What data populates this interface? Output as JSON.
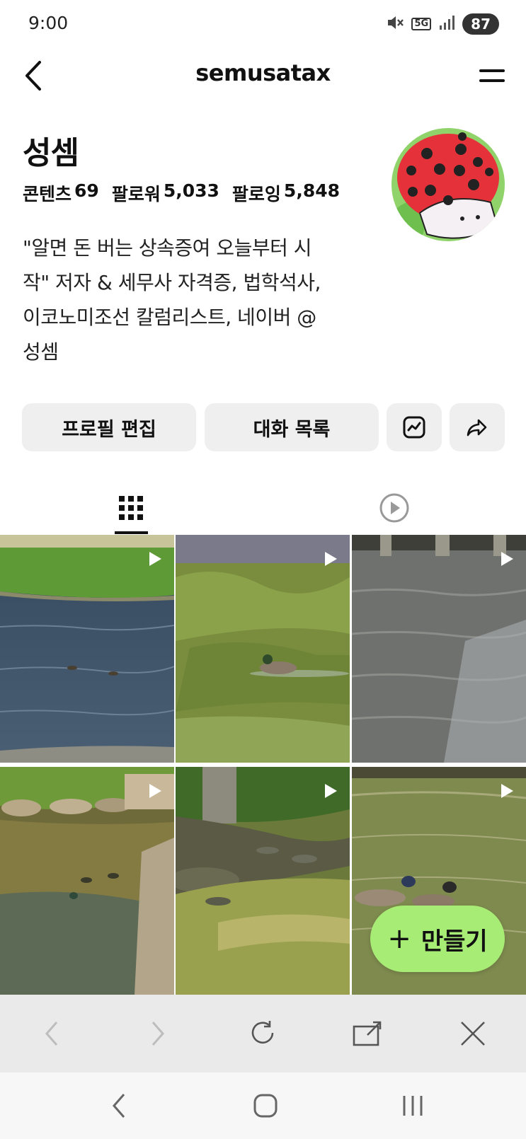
{
  "status_bar": {
    "time": "9:00",
    "network": "5G",
    "battery": "87",
    "icons": [
      "mute-icon",
      "5g-icon",
      "signal-icon",
      "battery-icon"
    ]
  },
  "header": {
    "title": "semusatax",
    "back_icon": "chevron-left-icon",
    "menu_icon": "hamburger-menu-icon"
  },
  "profile": {
    "name": "성셈",
    "stats": [
      {
        "label": "콘텐츠",
        "value": "69"
      },
      {
        "label": "팔로워",
        "value": "5,033"
      },
      {
        "label": "팔로잉",
        "value": "5,848"
      }
    ],
    "bio_lines": [
      "\"알면 돈 버는 상속증여 오늘부터 시",
      "작\" 저자 & 세무사 자격증, 법학석사,",
      "이코노미조선 칼럼리스트, 네이버 @",
      "성셈"
    ],
    "avatar_icon": "ladybug-avatar"
  },
  "actions": {
    "edit_profile": "프로필 편집",
    "conversation_list": "대화 목록",
    "insights_icon": "insights-icon",
    "share_icon": "share-icon"
  },
  "tabs": [
    {
      "icon": "grid-icon",
      "active": true
    },
    {
      "icon": "play-circle-icon",
      "active": false
    }
  ],
  "grid_items": [
    {
      "scene": "river-grass",
      "type": "video"
    },
    {
      "scene": "duck-green-water",
      "type": "video"
    },
    {
      "scene": "bridge-water",
      "type": "video"
    },
    {
      "scene": "rocks-ducks",
      "type": "video"
    },
    {
      "scene": "tree-bank-ducks",
      "type": "video"
    },
    {
      "scene": "resting-ducks",
      "type": "video"
    }
  ],
  "fab": {
    "label": "만들기",
    "icon": "plus-icon"
  },
  "browser_bar": [
    "back-icon",
    "forward-icon",
    "refresh-icon",
    "open-external-icon",
    "close-icon"
  ],
  "system_nav": [
    "back-icon",
    "home-icon",
    "recents-icon"
  ],
  "colors": {
    "fab": "#a7ec74",
    "button_bg": "#efefef",
    "browser_bar_bg": "#eaeaea"
  }
}
